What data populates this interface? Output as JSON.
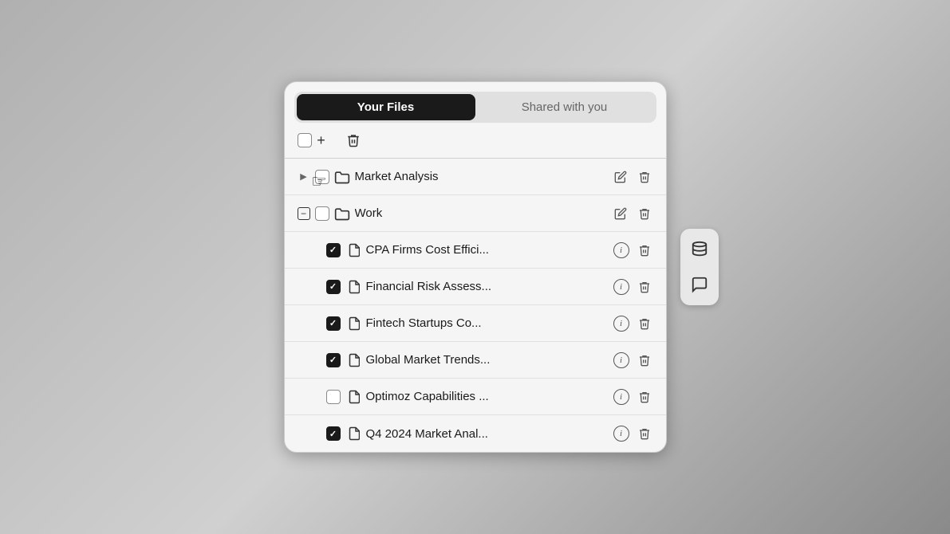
{
  "tabs": {
    "your_files": "Your Files",
    "shared_with_you": "Shared with you"
  },
  "toolbar": {
    "add_icon": "+",
    "delete_icon": "🗑"
  },
  "items": [
    {
      "id": "market-analysis",
      "type": "folder",
      "name": "Market Analysis",
      "checked": false,
      "expanded": false,
      "indent": "top"
    },
    {
      "id": "work",
      "type": "folder",
      "name": "Work",
      "checked": false,
      "expanded": true,
      "indent": "top"
    },
    {
      "id": "cpa-firms",
      "type": "file",
      "name": "CPA Firms Cost Effici...",
      "checked": true,
      "indent": "sub"
    },
    {
      "id": "financial-risk",
      "type": "file",
      "name": "Financial Risk Assess...",
      "checked": true,
      "indent": "sub"
    },
    {
      "id": "fintech-startups",
      "type": "file",
      "name": "Fintech Startups Co...",
      "checked": true,
      "indent": "sub"
    },
    {
      "id": "global-market",
      "type": "file",
      "name": "Global Market Trends...",
      "checked": true,
      "indent": "sub"
    },
    {
      "id": "optimoz",
      "type": "file",
      "name": "Optimoz Capabilities ...",
      "checked": false,
      "indent": "sub"
    },
    {
      "id": "q4-2024",
      "type": "file",
      "name": "Q4 2024 Market Anal...",
      "checked": true,
      "indent": "sub"
    }
  ],
  "right_panel": {
    "database_icon": "database",
    "chat_icon": "chat"
  }
}
